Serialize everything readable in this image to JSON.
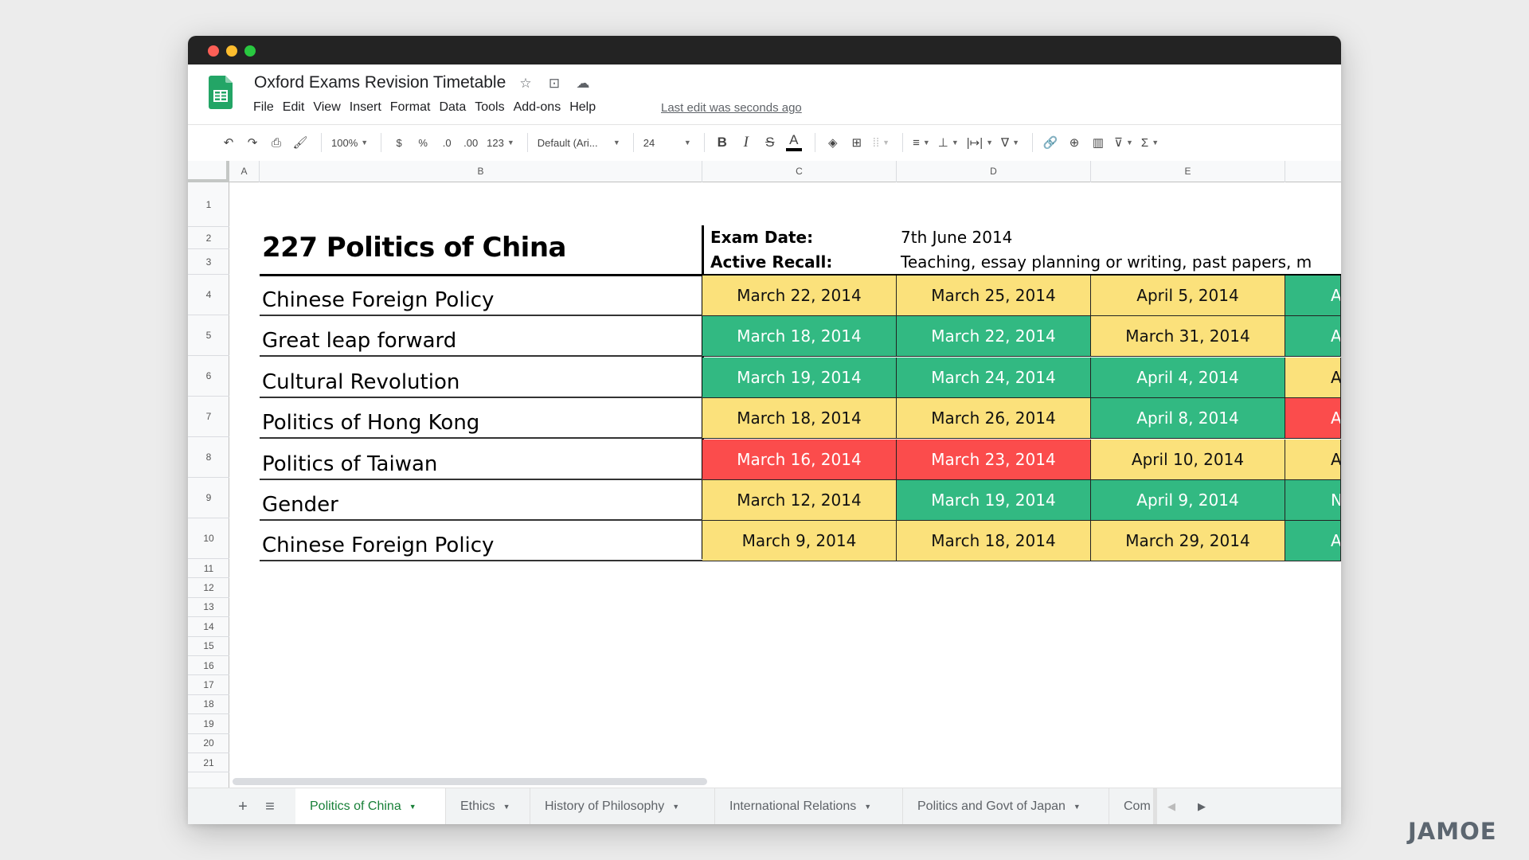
{
  "window": {
    "controls": [
      "close",
      "minimize",
      "maximize"
    ]
  },
  "app": {
    "doc_title": "Oxford Exams Revision Timetable",
    "title_icons": [
      "star-icon",
      "move-to-folder-icon",
      "cloud-status-icon"
    ],
    "menu": [
      "File",
      "Edit",
      "View",
      "Insert",
      "Format",
      "Data",
      "Tools",
      "Add-ons",
      "Help"
    ],
    "last_edit": "Last edit was seconds ago"
  },
  "toolbar": {
    "zoom": "100%",
    "currency": "$",
    "percent": "%",
    "decrease_decimal": ".0",
    "increase_decimal": ".00",
    "more_formats": "123",
    "font": "Default (Ari...",
    "font_size": "24",
    "bold": "B",
    "italic": "I",
    "strikethrough": "S",
    "text_color": "A"
  },
  "columns": [
    "A",
    "B",
    "C",
    "D",
    "E"
  ],
  "rows": [
    "1",
    "2",
    "3",
    "4",
    "5",
    "6",
    "7",
    "8",
    "9",
    "10",
    "11",
    "12",
    "13",
    "14",
    "15",
    "16",
    "17",
    "18",
    "19",
    "20",
    "21"
  ],
  "sheet": {
    "title": "227 Politics of China",
    "exam_date_label": "Exam Date:",
    "exam_date_value": "7th June 2014",
    "active_recall_label": "Active Recall:",
    "active_recall_value": "Teaching, essay planning or writing, past papers, m",
    "colors": {
      "yellow": "#fbe17b",
      "green": "#32b982",
      "red": "#fb4c4c"
    },
    "topics": [
      {
        "name": "Chinese Foreign Policy",
        "cells": [
          {
            "text": "March 22, 2014",
            "status": "yellow"
          },
          {
            "text": "March 25, 2014",
            "status": "yellow"
          },
          {
            "text": "April 5, 2014",
            "status": "yellow"
          },
          {
            "text": "A",
            "status": "green"
          }
        ]
      },
      {
        "name": "Great leap forward",
        "cells": [
          {
            "text": "March 18, 2014",
            "status": "green"
          },
          {
            "text": "March 22, 2014",
            "status": "green"
          },
          {
            "text": "March 31, 2014",
            "status": "yellow"
          },
          {
            "text": "A",
            "status": "green"
          }
        ]
      },
      {
        "name": "Cultural Revolution",
        "cells": [
          {
            "text": "March 19, 2014",
            "status": "green"
          },
          {
            "text": "March 24, 2014",
            "status": "green"
          },
          {
            "text": "April 4, 2014",
            "status": "green"
          },
          {
            "text": "A",
            "status": "yellow"
          }
        ]
      },
      {
        "name": "Politics of Hong Kong",
        "cells": [
          {
            "text": "March 18, 2014",
            "status": "yellow"
          },
          {
            "text": "March 26, 2014",
            "status": "yellow"
          },
          {
            "text": "April 8, 2014",
            "status": "green"
          },
          {
            "text": "A",
            "status": "red"
          }
        ]
      },
      {
        "name": "Politics of Taiwan",
        "cells": [
          {
            "text": "March 16, 2014",
            "status": "red"
          },
          {
            "text": "March 23, 2014",
            "status": "red"
          },
          {
            "text": "April 10, 2014",
            "status": "yellow"
          },
          {
            "text": "A",
            "status": "yellow"
          }
        ]
      },
      {
        "name": "Gender",
        "cells": [
          {
            "text": "March 12, 2014",
            "status": "yellow"
          },
          {
            "text": "March 19, 2014",
            "status": "green"
          },
          {
            "text": "April 9, 2014",
            "status": "green"
          },
          {
            "text": "N",
            "status": "green"
          }
        ]
      },
      {
        "name": "Chinese Foreign Policy",
        "cells": [
          {
            "text": "March 9, 2014",
            "status": "yellow"
          },
          {
            "text": "March 18, 2014",
            "status": "yellow"
          },
          {
            "text": "March 29, 2014",
            "status": "yellow"
          },
          {
            "text": "A",
            "status": "green"
          }
        ]
      }
    ]
  },
  "tabs": {
    "add_label": "+",
    "list_label": "≡",
    "items": [
      {
        "label": "Politics of China",
        "active": true
      },
      {
        "label": "Ethics",
        "active": false
      },
      {
        "label": "History of Philosophy",
        "active": false
      },
      {
        "label": "International Relations",
        "active": false
      },
      {
        "label": "Politics and Govt of Japan",
        "active": false
      },
      {
        "label": "Com",
        "active": false
      }
    ],
    "prev_label": "◀",
    "next_label": "▶"
  },
  "brand": "JAMOE"
}
